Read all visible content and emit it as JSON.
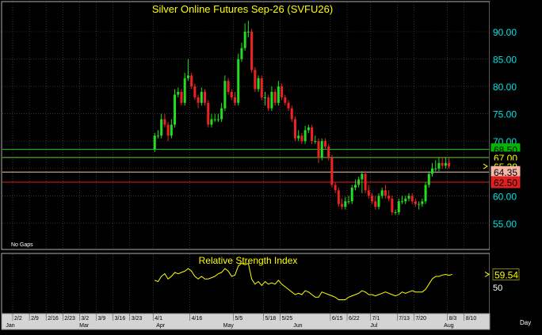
{
  "chart_data": {
    "type": "candlestick",
    "title": "Silver Online Futures Sep-26 (SVFU26)",
    "note": "No Gaps",
    "x_unit_label": "Day",
    "y_ticks": [
      "90.00",
      "85.00",
      "80.00",
      "75.00",
      "70.00",
      "65.00",
      "60.00",
      "55.00"
    ],
    "ylim": [
      50.2,
      95.5
    ],
    "date_labels": [
      {
        "label": "2/2",
        "i": 0
      },
      {
        "label": "2/9",
        "i": 5
      },
      {
        "label": "2/16",
        "i": 10
      },
      {
        "label": "2/23",
        "i": 15
      },
      {
        "label": "3/2",
        "i": 20
      },
      {
        "label": "3/9",
        "i": 25
      },
      {
        "label": "3/16",
        "i": 30
      },
      {
        "label": "3/23",
        "i": 35
      },
      {
        "label": "4/1",
        "i": 42
      },
      {
        "label": "4/16",
        "i": 53
      },
      {
        "label": "5/5",
        "i": 66
      },
      {
        "label": "5/18",
        "i": 75
      },
      {
        "label": "5/25",
        "i": 80
      },
      {
        "label": "6/15",
        "i": 95
      },
      {
        "label": "6/22",
        "i": 100
      },
      {
        "label": "7/1",
        "i": 107
      },
      {
        "label": "7/13",
        "i": 115
      },
      {
        "label": "7/20",
        "i": 120
      },
      {
        "label": "8/3",
        "i": 130
      },
      {
        "label": "8/10",
        "i": 135
      }
    ],
    "month_labels": [
      {
        "label": "Jan",
        "i": -3
      },
      {
        "label": "Mar",
        "i": 19
      },
      {
        "label": "Apr",
        "i": 42
      },
      {
        "label": "May",
        "i": 62
      },
      {
        "label": "Jun",
        "i": 83
      },
      {
        "label": "Jul",
        "i": 106
      },
      {
        "label": "Aug",
        "i": 128
      }
    ],
    "levels": [
      {
        "value": 68.5,
        "label": "68.50",
        "line": "#00cc00",
        "bg": "#00b800",
        "fg": "#000000"
      },
      {
        "value": 67.0,
        "label": "67.00",
        "line": "#66cc44",
        "bg": "#000000",
        "fg": "#ffff00"
      },
      {
        "value": 65.39,
        "label": "65.39",
        "line": null,
        "bg": "#000000",
        "fg": "#ffff00"
      },
      {
        "value": 64.35,
        "label": "64.35",
        "line": "#f4c3b4",
        "bg": "#f4b8a8",
        "fg": "#000000"
      },
      {
        "value": 62.5,
        "label": "62.50",
        "line": "#e02020",
        "bg": "#e02020",
        "fg": "#000000"
      }
    ],
    "last_price": 65.39,
    "ohlc": {
      "start_index": 42,
      "open": [
        68.5,
        71,
        71,
        74,
        73,
        71,
        73,
        78.5,
        79,
        77,
        81.5,
        82,
        80,
        78,
        77,
        79,
        77,
        73,
        74,
        74,
        74,
        76,
        81,
        79,
        78,
        77,
        85,
        87,
        90,
        90,
        83,
        79.5,
        81.5,
        78,
        78,
        76,
        79,
        77,
        80,
        78,
        77,
        76,
        74,
        70.5,
        71,
        70,
        72,
        72.5,
        70,
        70,
        67,
        70,
        69,
        67,
        62,
        61,
        58.5,
        58,
        59,
        59,
        61.5,
        62,
        63,
        64,
        61,
        60,
        59,
        58,
        60,
        61,
        60,
        59.5,
        57,
        57,
        59,
        59,
        59.5,
        60,
        59,
        58.5,
        58.5,
        59,
        62,
        64,
        65,
        65,
        66,
        65.5,
        66
      ],
      "close": [
        71,
        71,
        74,
        73,
        71,
        73,
        78.5,
        79,
        77,
        81.5,
        82,
        80,
        78,
        77,
        79,
        77,
        73,
        74,
        74,
        74,
        76,
        81,
        79,
        78,
        77,
        85,
        87,
        90,
        90,
        83,
        79.5,
        81.5,
        78,
        78,
        76,
        79,
        77,
        80,
        78,
        77,
        76,
        74,
        70.5,
        71,
        70,
        72,
        72.5,
        70,
        70,
        67,
        70,
        69,
        67,
        62,
        61,
        58.5,
        58,
        59,
        59,
        61.5,
        62,
        63,
        64,
        61,
        60,
        59,
        58,
        60,
        61,
        60,
        59.5,
        57,
        57,
        59,
        59,
        59.5,
        60,
        59,
        58.5,
        58.5,
        59,
        62,
        64,
        65,
        65,
        66,
        65.5,
        66,
        65.39
      ],
      "high": [
        71.5,
        72,
        75,
        75,
        73.5,
        74,
        79.5,
        79.8,
        79.5,
        82.5,
        85,
        82.5,
        80.5,
        78.5,
        79.8,
        79.5,
        77.5,
        75,
        75,
        75,
        77,
        82,
        81.5,
        79.5,
        79,
        86,
        88,
        91.5,
        92,
        90.5,
        83.5,
        82,
        82,
        79,
        78.5,
        80,
        79.5,
        81,
        80.5,
        78.5,
        77.5,
        76.5,
        74.5,
        72,
        71.5,
        72.8,
        73,
        73,
        71,
        70.5,
        70.5,
        70.5,
        69.5,
        67.5,
        62.5,
        61.5,
        59.5,
        59.8,
        60,
        62,
        63,
        63.5,
        64.5,
        64.5,
        62,
        60.5,
        60,
        60.5,
        61.5,
        62,
        61,
        60,
        57.5,
        59.5,
        60,
        60,
        60.5,
        60.5,
        59.5,
        59,
        59.5,
        62.5,
        64.5,
        66,
        66.5,
        67,
        67,
        67,
        67
      ],
      "low": [
        68,
        70.5,
        70.5,
        72.5,
        70,
        70.5,
        72.5,
        78,
        76.5,
        76.5,
        81,
        79.5,
        77.5,
        76,
        76.5,
        76.5,
        72.5,
        72.5,
        73.5,
        73.5,
        73.5,
        75.5,
        78.5,
        77.5,
        76.5,
        76.5,
        84.5,
        86.5,
        89,
        82.5,
        79,
        79,
        77.5,
        76.5,
        75.5,
        75.5,
        76.5,
        76.5,
        77.5,
        76.5,
        75.5,
        73.5,
        70,
        70,
        69.5,
        69.5,
        71.5,
        69.5,
        69.5,
        66,
        66.5,
        68.5,
        66.5,
        61.5,
        60.5,
        58,
        57.5,
        57.5,
        58.5,
        58.5,
        61,
        61.5,
        60.5,
        60.5,
        59.5,
        58.5,
        57.5,
        57.5,
        59.5,
        59.5,
        59,
        56.5,
        56.5,
        56.5,
        58.5,
        58.5,
        59,
        58.5,
        58,
        57.5,
        58,
        58.5,
        61.5,
        63.5,
        64.5,
        64.5,
        65,
        65,
        65
      ]
    },
    "rsi": {
      "title": "Relative Strength Index",
      "scale_tick": "50",
      "last_value": 59.54,
      "last_label": "59.54",
      "start_index": 42,
      "values": [
        55,
        54,
        58,
        60,
        56,
        58,
        61,
        60,
        61,
        62,
        64,
        62,
        58,
        56,
        58,
        56,
        56,
        57,
        58,
        60,
        61,
        64,
        62,
        58,
        59,
        66,
        68,
        67,
        68,
        56,
        52,
        54,
        51,
        54,
        52,
        53,
        52,
        55,
        52,
        50,
        48,
        46,
        44,
        45,
        44,
        47,
        46,
        44,
        42,
        42,
        46,
        45,
        44,
        43,
        42,
        40,
        40,
        40,
        42,
        43,
        44,
        45,
        47,
        46,
        44,
        44,
        43,
        44,
        45,
        46,
        45,
        44,
        43,
        44,
        46,
        45,
        46,
        47,
        46,
        46,
        46,
        48,
        52,
        56,
        58,
        58,
        59,
        59.5,
        58.8,
        59.54
      ]
    }
  }
}
